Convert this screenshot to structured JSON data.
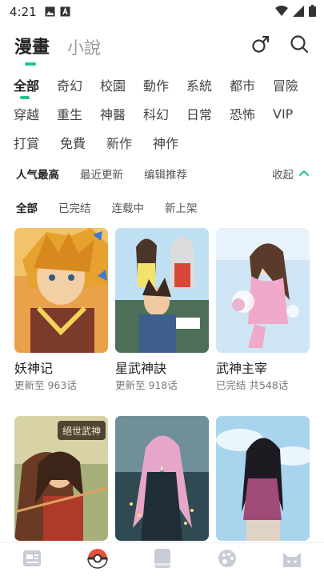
{
  "status_bar": {
    "time": "4:21"
  },
  "top_tabs": [
    {
      "label": "漫畫",
      "active": true
    },
    {
      "label": "小說",
      "active": false
    }
  ],
  "genres": [
    [
      "全部",
      "奇幻",
      "校園",
      "動作",
      "系統",
      "都市",
      "冒險"
    ],
    [
      "穿越",
      "重生",
      "神醫",
      "科幻",
      "日常",
      "恐怖",
      "VIP"
    ],
    [
      "打賞",
      "免費",
      "新作",
      "神作"
    ]
  ],
  "active_genre": "全部",
  "sort_options": [
    {
      "label": "人气最高",
      "active": true
    },
    {
      "label": "最近更新",
      "active": false
    },
    {
      "label": "编辑推荐",
      "active": false
    }
  ],
  "collapse_label": "收起",
  "status_filters": [
    {
      "label": "全部",
      "active": true
    },
    {
      "label": "已完结",
      "active": false
    },
    {
      "label": "连载中",
      "active": false
    },
    {
      "label": "新上架",
      "active": false
    }
  ],
  "comics": [
    {
      "title": "妖神记",
      "progress": "更新至 963话"
    },
    {
      "title": "星武神訣",
      "progress": "更新至 918话"
    },
    {
      "title": "武神主宰",
      "progress": "已完结 共548话"
    },
    {
      "title": "",
      "progress": ""
    },
    {
      "title": "",
      "progress": ""
    },
    {
      "title": "",
      "progress": ""
    }
  ],
  "cover_logo_text": "絕世武神",
  "bottom_nav": [
    {
      "icon": "news-icon",
      "active": false
    },
    {
      "icon": "pokeball-icon",
      "active": true
    },
    {
      "icon": "book-icon",
      "active": false
    },
    {
      "icon": "palette-icon",
      "active": false
    },
    {
      "icon": "cat-face-icon",
      "active": false
    }
  ],
  "colors": {
    "accent": "#23c48c",
    "nav_inactive": "#c7ccd6",
    "pokeball_red": "#e8503a"
  }
}
